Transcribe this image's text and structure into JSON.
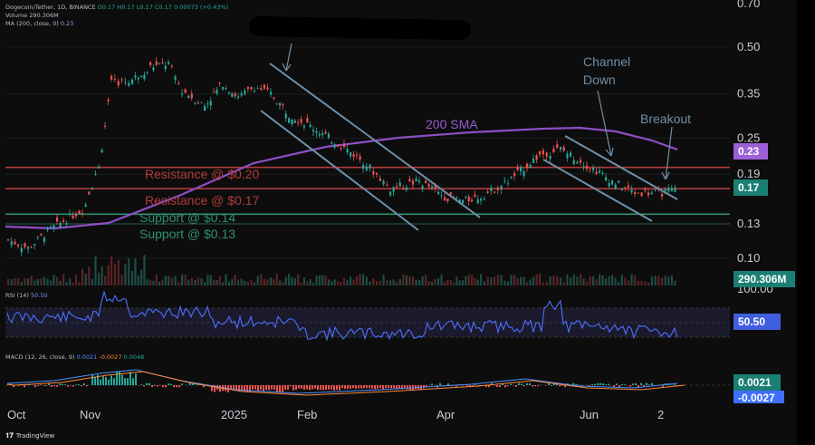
{
  "header": {
    "line1_prefix": "Dogecoin/Tether, 1D, BINANCE",
    "line1_values": "O0.17  H0.17  L0.17  C0.17  0.00073 (+0.43%)",
    "line2_label": "Volume",
    "line2_value": "290.306M",
    "line3_label": "MA (200, close, 0)",
    "line3_value": "0.23"
  },
  "price_axis": [
    "0.70",
    "0.50",
    "0.35",
    "0.25",
    "0.19",
    "0.13",
    "0.10"
  ],
  "tags": {
    "ma": "0.23",
    "price": "0.17",
    "volume": "290.306M",
    "rsi": "50.50",
    "macd_pos": "0.0021",
    "macd_neg": "-0.0027",
    "rsi_top": "100.00"
  },
  "rsi_header": {
    "label": "RSI (14)",
    "value": "50.50"
  },
  "macd_header": {
    "label": "MACD (12, 26, close, 9)",
    "v1": "0.0021",
    "v2": "-0.0027",
    "v3": "0.0048"
  },
  "time_axis": [
    "Oct",
    "Nov",
    "2025",
    "Feb",
    "Apr",
    "Jun",
    "2"
  ],
  "annotations": {
    "res1": "Resistance @ $0.20",
    "res2": "Resistance @ $0.17",
    "sup1": "Support @ $0.14",
    "sup2": "Support @ $0.13",
    "sma": "200 SMA",
    "channel_line1": "Channel",
    "channel_line2": "Down",
    "breakout": "Breakout"
  },
  "footer": {
    "brand": "TradingView"
  },
  "colors": {
    "resistance": "#b23a3a",
    "support": "#2f8f6f",
    "sma": "#8e4ec6",
    "channel": "#6f8fa8",
    "up": "#26a69a",
    "down": "#ef5350",
    "rsi": "#4f6fff"
  },
  "chart_data": {
    "type": "line",
    "title": "Dogecoin/Tether, 1D, BINANCE",
    "price_series": {
      "x": [
        "Oct 1",
        "Oct 10",
        "Oct 20",
        "Nov 1",
        "Nov 8",
        "Nov 12",
        "Nov 20",
        "Dec 1",
        "Dec 8",
        "Dec 15",
        "Dec 25",
        "2025 Jan 1",
        "Jan 10",
        "Jan 18",
        "Jan 25",
        "Feb 1",
        "Feb 10",
        "Feb 20",
        "Mar 1",
        "Mar 10",
        "Mar 20",
        "Apr 1",
        "Apr 10",
        "Apr 20",
        "May 1",
        "May 10",
        "May 20",
        "Jun 1",
        "Jun 10",
        "Jun 20",
        "Jul 1",
        "Jul 5"
      ],
      "close": [
        0.115,
        0.108,
        0.125,
        0.145,
        0.2,
        0.38,
        0.39,
        0.43,
        0.44,
        0.36,
        0.32,
        0.38,
        0.34,
        0.37,
        0.35,
        0.3,
        0.27,
        0.24,
        0.21,
        0.17,
        0.18,
        0.16,
        0.155,
        0.16,
        0.18,
        0.22,
        0.23,
        0.21,
        0.18,
        0.165,
        0.165,
        0.17
      ]
    },
    "ma200": {
      "name": "200 SMA",
      "last": 0.23
    },
    "levels": [
      {
        "name": "Resistance @ $0.20",
        "value": 0.2
      },
      {
        "name": "Resistance @ $0.17",
        "value": 0.17
      },
      {
        "name": "Support @ $0.14",
        "value": 0.14
      },
      {
        "name": "Support @ $0.13",
        "value": 0.13
      }
    ],
    "volume_last": "290.306M",
    "rsi_last": 50.5,
    "macd": {
      "macd": 0.0021,
      "signal": -0.0027,
      "histogram": 0.0048
    },
    "yticks": [
      0.7,
      0.5,
      0.35,
      0.25,
      0.19,
      0.13,
      0.1
    ],
    "y_scale": "log"
  }
}
